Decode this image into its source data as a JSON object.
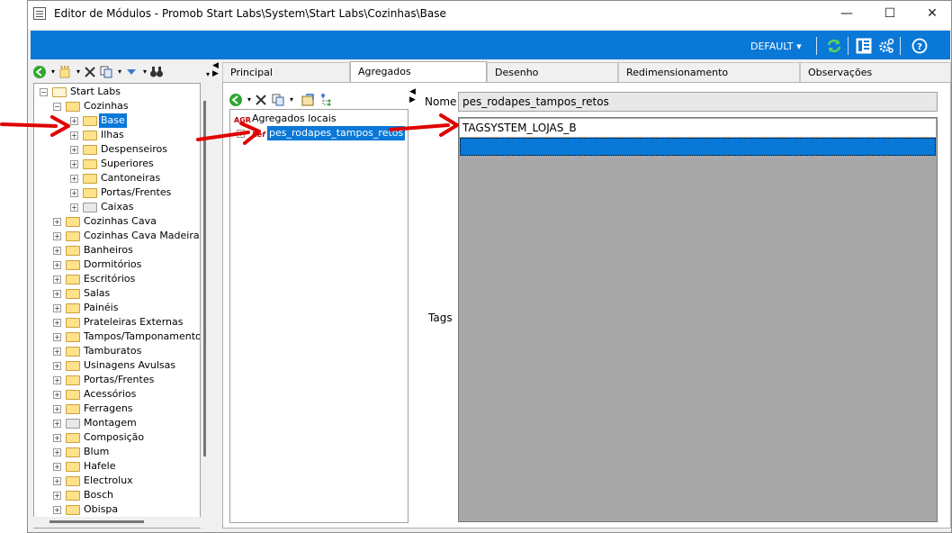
{
  "window": {
    "title": "Editor de Módulos - Promob Start Labs\\System\\Start Labs\\Cozinhas\\Base",
    "minimize": "—",
    "maximize": "☐",
    "close": "✕"
  },
  "bluebar": {
    "profile": "DEFAULT ▾",
    "accent": "#0a78d7"
  },
  "left_tree": {
    "root": "Start Labs",
    "items": [
      {
        "label": "Cozinhas",
        "level": 1,
        "expanded": true
      },
      {
        "label": "Base",
        "level": 2,
        "selected": true
      },
      {
        "label": "Ilhas",
        "level": 2
      },
      {
        "label": "Despenseiros",
        "level": 2
      },
      {
        "label": "Superiores",
        "level": 2
      },
      {
        "label": "Cantoneiras",
        "level": 2
      },
      {
        "label": "Portas/Frentes",
        "level": 2
      },
      {
        "label": "Caixas",
        "level": 2,
        "gray": true
      },
      {
        "label": "Cozinhas Cava",
        "level": 1
      },
      {
        "label": "Cozinhas Cava Madeira",
        "level": 1
      },
      {
        "label": "Banheiros",
        "level": 1
      },
      {
        "label": "Dormitórios",
        "level": 1
      },
      {
        "label": "Escritórios",
        "level": 1
      },
      {
        "label": "Salas",
        "level": 1
      },
      {
        "label": "Painéis",
        "level": 1
      },
      {
        "label": "Prateleiras Externas",
        "level": 1
      },
      {
        "label": "Tampos/Tamponamento",
        "level": 1
      },
      {
        "label": "Tamburatos",
        "level": 1
      },
      {
        "label": "Usinagens Avulsas",
        "level": 1
      },
      {
        "label": "Portas/Frentes",
        "level": 1
      },
      {
        "label": "Acessórios",
        "level": 1
      },
      {
        "label": "Ferragens",
        "level": 1
      },
      {
        "label": "Montagem",
        "level": 1,
        "gray": true
      },
      {
        "label": "Composição",
        "level": 1
      },
      {
        "label": "Blum",
        "level": 1
      },
      {
        "label": "Hafele",
        "level": 1
      },
      {
        "label": "Electrolux",
        "level": 1
      },
      {
        "label": "Bosch",
        "level": 1
      },
      {
        "label": "Obispa",
        "level": 1
      }
    ]
  },
  "tabs": [
    "Principal",
    "Agregados",
    "Desenho",
    "Redimensionamento",
    "Observações"
  ],
  "active_tab": "Agregados",
  "aggregates": {
    "root_badge": "AGR",
    "root_label": "Agregados locais",
    "child_badge": "Ref",
    "child_label": "pes_rodapes_tampos_retos"
  },
  "details": {
    "nome_label": "Nome",
    "nome_value": "pes_rodapes_tampos_retos",
    "tags_label": "Tags",
    "tags": [
      "TAGSYSTEM_LOJAS_B",
      ""
    ]
  },
  "annotation_color": "#e00000"
}
